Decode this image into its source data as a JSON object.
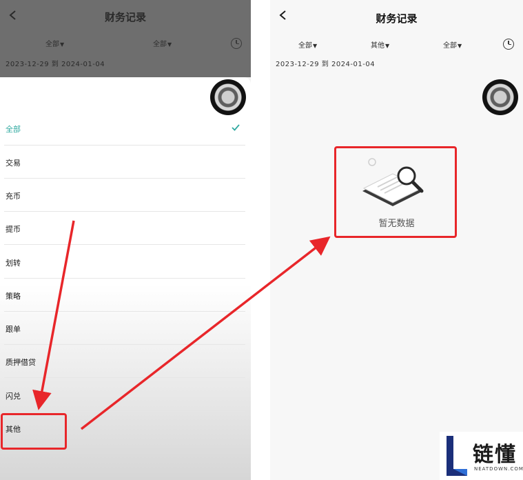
{
  "left": {
    "header": {
      "title": "财务记录",
      "filters": [
        {
          "label": "全部"
        },
        {
          "label": "全部"
        }
      ],
      "date_range": "2023-12-29 到 2024-01-04"
    },
    "sheet": {
      "items": [
        {
          "label": "全部",
          "selected": true
        },
        {
          "label": "交易"
        },
        {
          "label": "充币"
        },
        {
          "label": "提币"
        },
        {
          "label": "划转"
        },
        {
          "label": "策略"
        },
        {
          "label": "跟单"
        },
        {
          "label": "质押借贷"
        },
        {
          "label": "闪兑"
        },
        {
          "label": "其他"
        }
      ]
    }
  },
  "right": {
    "header": {
      "title": "财务记录",
      "filters": [
        {
          "label": "全部"
        },
        {
          "label": "其他"
        },
        {
          "label": "全部"
        }
      ],
      "date_range": "2023-12-29 到 2024-01-04"
    },
    "empty_state": {
      "message": "暂无数据",
      "icon": "empty-search-illustration"
    }
  },
  "watermark": {
    "logo_text": "链懂",
    "logo_en": "NEATDOWN.COM"
  },
  "colors": {
    "accent": "#2fa9a0",
    "highlight_red": "#e8262a",
    "overlay": "#6e6e6e"
  }
}
